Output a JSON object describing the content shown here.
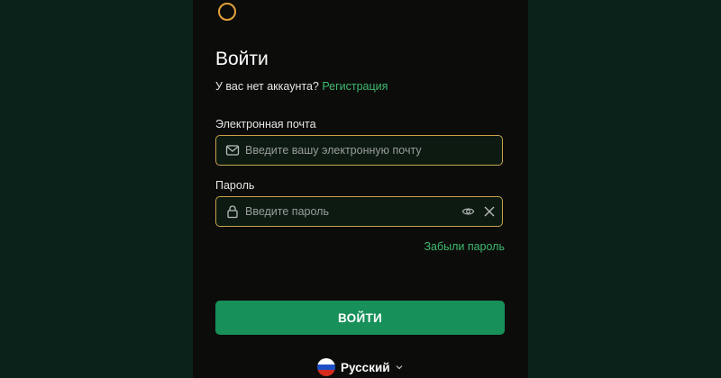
{
  "login": {
    "title": "Войти",
    "no_account_text": "У вас нет аккаунта?",
    "signup_link": "Регистрация",
    "email": {
      "label": "Электронная почта",
      "placeholder": "Введите вашу электронную почту",
      "value": ""
    },
    "password": {
      "label": "Пароль",
      "placeholder": "Введите пароль",
      "value": ""
    },
    "forgot_link": "Забыли пароль",
    "submit_label": "ВОЙТИ"
  },
  "language": {
    "selected": "Русский"
  },
  "colors": {
    "accent_green": "#17905a",
    "link_green": "#3dbb6e",
    "field_border": "#c9a24a",
    "logo_ring": "#e2a23a",
    "panel_bg": "#0c0c0b",
    "page_bg": "#0a2219"
  },
  "icons": {
    "logo": "logo-ring-icon",
    "email": "mail-icon",
    "password": "lock-icon",
    "show_password": "eye-icon",
    "clear": "close-icon",
    "language_flag": "russia-flag-icon",
    "language_toggle": "chevron-down-icon"
  }
}
